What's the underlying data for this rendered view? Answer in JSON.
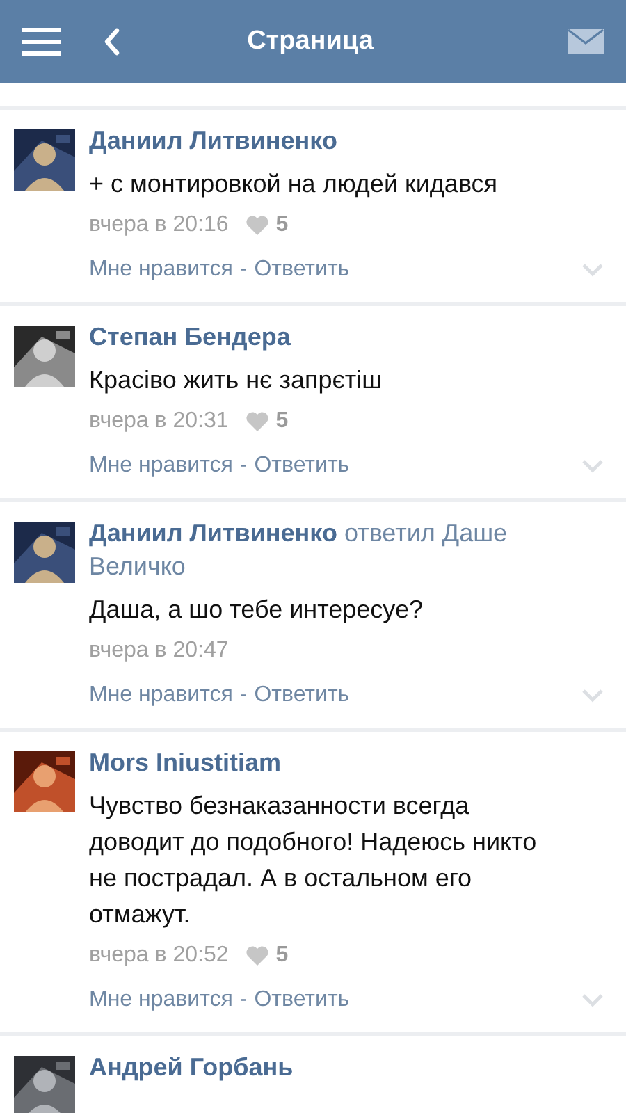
{
  "header": {
    "title": "Страница"
  },
  "comments": [
    {
      "author": "Даниил Литвиненко",
      "text": "+ с монтировкой на людей кидався",
      "time": "вчера в 20:16",
      "likes": "5",
      "actions": {
        "like": "Мне нравится",
        "separator": "-",
        "reply": "Ответить"
      }
    },
    {
      "author": "Степан Бендера",
      "text": "Красіво жить нє запрєтіш",
      "time": "вчера в 20:31",
      "likes": "5",
      "actions": {
        "like": "Мне нравится",
        "separator": "-",
        "reply": "Ответить"
      }
    },
    {
      "author": "Даниил Литвиненко",
      "reply_to": "ответил Даше Величко",
      "text": "Даша, а шо тебе интересуе?",
      "time": "вчера в 20:47",
      "actions": {
        "like": "Мне нравится",
        "separator": "-",
        "reply": "Ответить"
      }
    },
    {
      "author": "Mors Iniustitiam",
      "text": "Чувство безнаказанности всегда доводит до подобного! Надеюсь никто не пострадал. А в остальном его отмажут.",
      "time": "вчера в 20:52",
      "likes": "5",
      "actions": {
        "like": "Мне нравится",
        "separator": "-",
        "reply": "Ответить"
      }
    },
    {
      "author": "Андрей Горбань"
    }
  ]
}
